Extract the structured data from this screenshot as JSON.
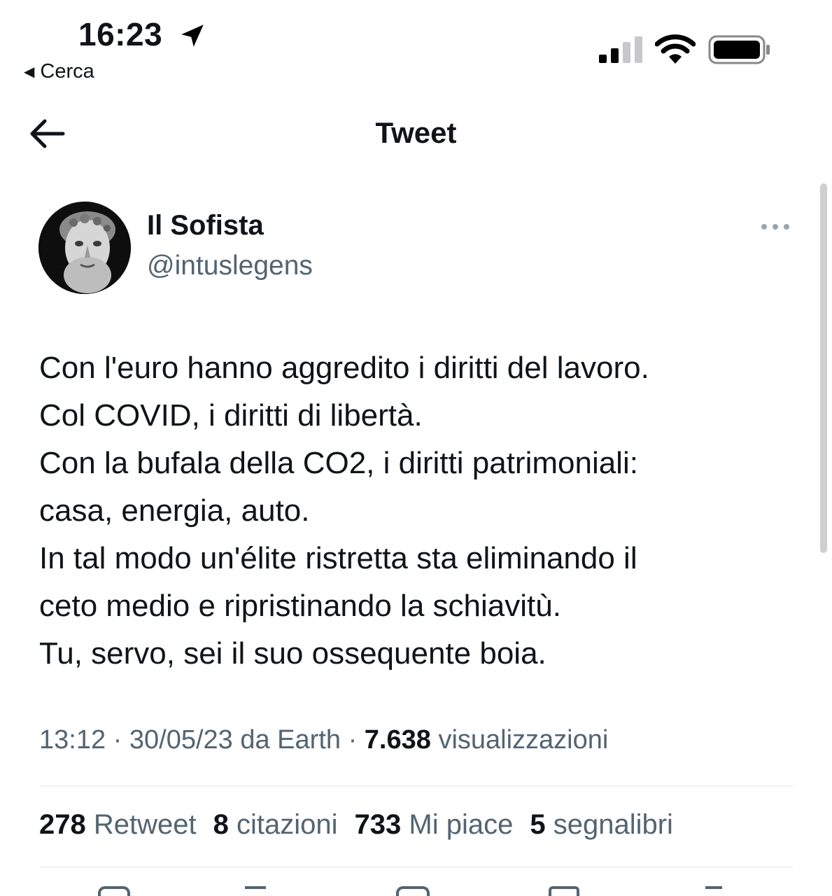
{
  "status_bar": {
    "time": "16:23",
    "back_app_label": "Cerca"
  },
  "header": {
    "title": "Tweet"
  },
  "tweet": {
    "author_name": "Il Sofista",
    "author_handle": "@intuslegens",
    "text_lines": [
      "Con l'euro hanno aggredito i diritti del lavoro.",
      "Col COVID, i diritti di libertà.",
      "Con la bufala della CO2, i diritti patrimoniali:",
      "casa, energia, auto.",
      "In tal modo un'élite ristretta sta eliminando il",
      "ceto medio e ripristinando la schiavitù.",
      "Tu, servo, sei il suo ossequente boia."
    ],
    "meta": {
      "time": "13:12",
      "date": "30/05/23",
      "source": "da Earth",
      "views_count": "7.638",
      "views_label": "visualizzazioni"
    },
    "stats": {
      "retweets_count": "278",
      "retweets_label": "Retweet",
      "quotes_count": "8",
      "quotes_label": "citazioni",
      "likes_count": "733",
      "likes_label": "Mi piace",
      "bookmarks_count": "5",
      "bookmarks_label": "segnalibri"
    }
  },
  "colors": {
    "text_primary": "#0f1419",
    "text_secondary": "#536471",
    "divider": "#eff3f4"
  }
}
